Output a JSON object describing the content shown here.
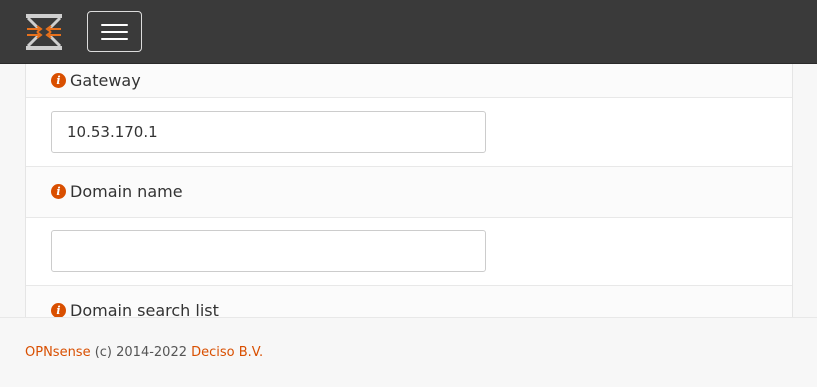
{
  "header": {
    "logo_icon": "opnsense-logo-icon",
    "menu_icon": "hamburger-menu-icon",
    "brand_color": "#d94f00"
  },
  "form": {
    "gateway": {
      "label": "Gateway",
      "value": "10.53.170.1",
      "icon": "info-icon"
    },
    "domain_name": {
      "label": "Domain name",
      "value": "",
      "icon": "info-icon"
    },
    "domain_search_list": {
      "label": "Domain search list",
      "icon": "info-icon"
    }
  },
  "footer": {
    "product": "OPNsense",
    "copyright": " (c) 2014-2022 ",
    "company": "Deciso B.V."
  }
}
